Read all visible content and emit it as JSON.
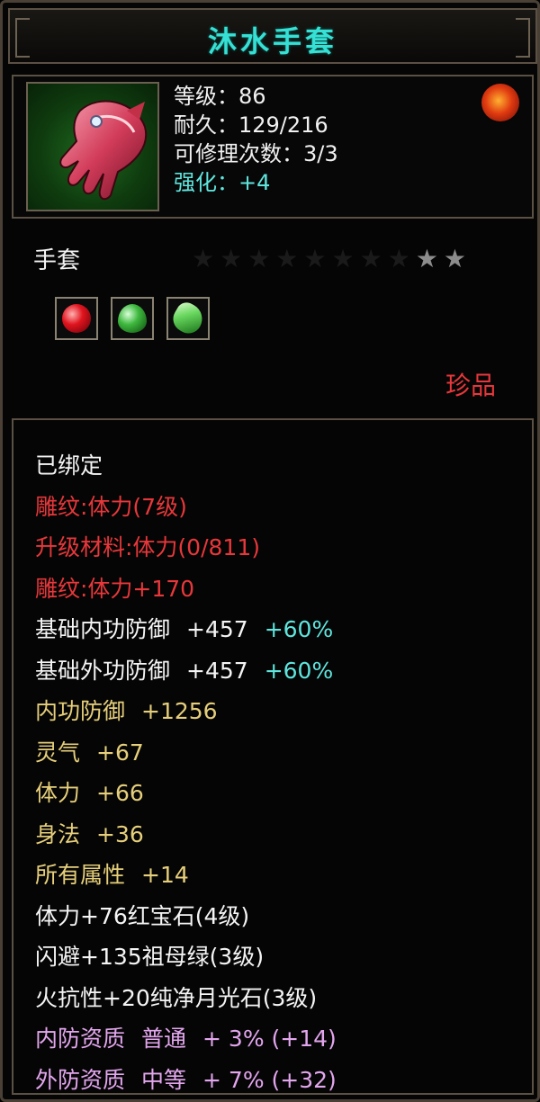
{
  "title": "沐水手套",
  "header": {
    "level": "等级：86",
    "durability": "耐久：129/216",
    "repair": "可修理次数：3/3",
    "enhance": "强化：+4",
    "item_icon": "gauntlet-icon",
    "seal_icon": "dragon-seal-icon"
  },
  "type": {
    "label": "手套",
    "stars_dim": "★★★★★★★★",
    "stars_lit": "★★"
  },
  "gems": [
    "ruby-gem-icon",
    "emerald-gem-icon",
    "moonstone-gem-icon"
  ],
  "quality": "珍品",
  "attributes": {
    "bound": "已绑定",
    "engrave": "雕纹:体力(7级)",
    "upgrade": "升级材料:体力(0/811)",
    "engrave_bonus": "雕纹:体力+170",
    "base_inner": {
      "label": "基础内功防御",
      "value": "+457",
      "pct": "+60%"
    },
    "base_outer": {
      "label": "基础外功防御",
      "value": "+457",
      "pct": "+60%"
    },
    "inner_def": {
      "label": "内功防御",
      "value": "+1256"
    },
    "spirit": {
      "label": "灵气",
      "value": "+67"
    },
    "stamina": {
      "label": "体力",
      "value": "+66"
    },
    "agility": {
      "label": "身法",
      "value": "+36"
    },
    "all_attr": {
      "label": "所有属性",
      "value": "+14"
    },
    "gem1": "体力+76红宝石(4级)",
    "gem2": "闪避+135祖母绿(3级)",
    "gem3": "火抗性+20纯净月光石(3级)",
    "inner_quality": {
      "label": "内防资质",
      "grade": "普通",
      "value": "+ 3% (+14)"
    },
    "outer_quality": {
      "label": "外防资质",
      "grade": "中等",
      "value": "+ 7% (+32)"
    }
  },
  "colors": {
    "title": "#36e0d4",
    "red": "#e8373a",
    "gold": "#e6cf7a",
    "cyan": "#5fe6de",
    "pink": "#e3a6ee",
    "border": "#5b5044"
  }
}
